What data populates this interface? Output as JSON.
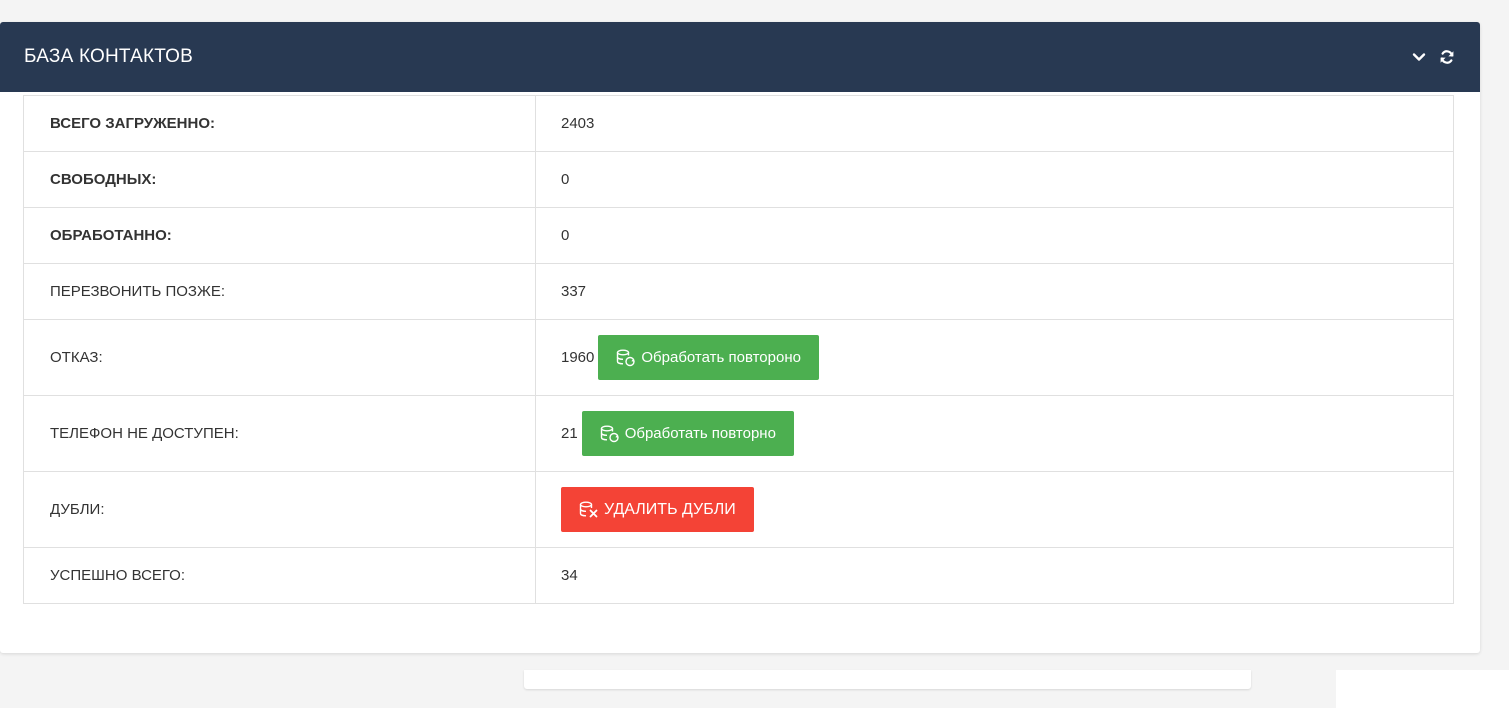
{
  "panel": {
    "title": "БАЗА КОНТАКТОВ",
    "icons": [
      "chevron-down-icon",
      "refresh-icon"
    ]
  },
  "colors": {
    "header_bg": "#283952",
    "success": "#4caf50",
    "danger": "#f44336"
  },
  "rows": [
    {
      "label": "ВСЕГО ЗАГРУЖЕННО:",
      "value": "2403"
    },
    {
      "label": "СВОБОДНЫХ:",
      "value": "0"
    },
    {
      "label": "ОБРАБОТАННО:",
      "value": "0"
    },
    {
      "label": "ПЕРЕЗВОНИТЬ ПОЗЖЕ:",
      "value": "337"
    },
    {
      "label": "ОТКАЗ:",
      "value": "1960",
      "button": "Обработать повтороно",
      "button_icon": "database-refresh-icon"
    },
    {
      "label": "ТЕЛЕФОН НЕ ДОСТУПЕН:",
      "value": "21",
      "button": "Обработать повторно",
      "button_icon": "database-refresh-icon"
    },
    {
      "label": "ДУБЛИ:",
      "button": "УДАЛИТЬ ДУБЛИ",
      "button_icon": "database-delete-icon"
    },
    {
      "label": "УСПЕШНО ВСЕГО:",
      "value": "34"
    }
  ]
}
